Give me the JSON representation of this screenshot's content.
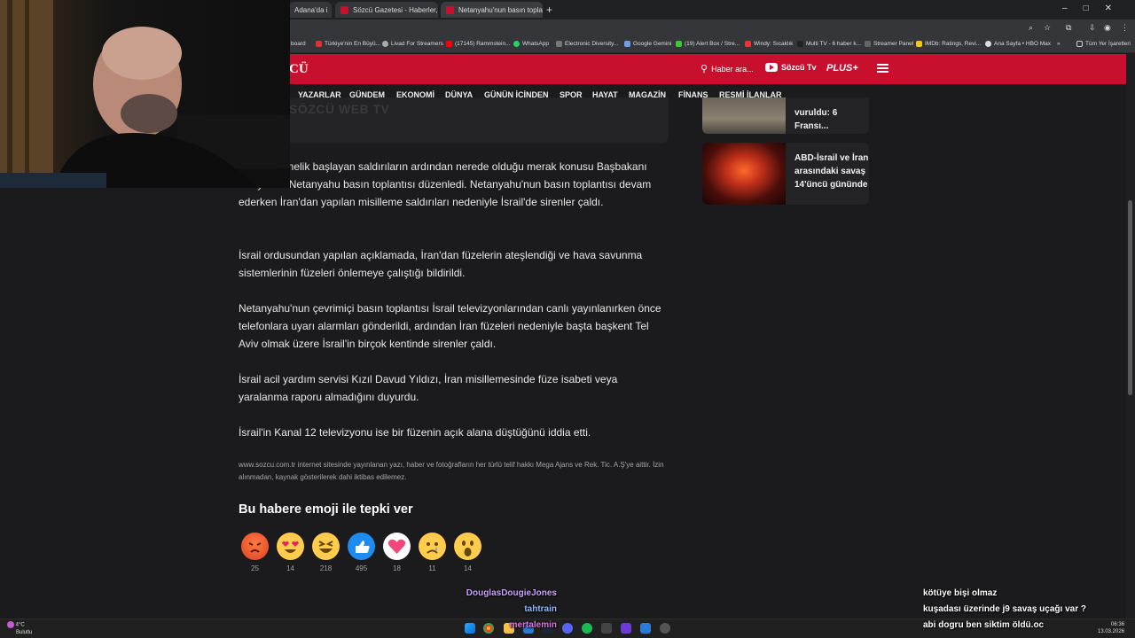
{
  "browser": {
    "tabs": [
      {
        "label": "Adana'da i",
        "active": false
      },
      {
        "label": "Sözcü Gazetesi - Haberler, son",
        "active": false
      },
      {
        "label": "Netanyahu'nun basın toplantısı",
        "active": true
      }
    ],
    "bookmarks": [
      "board",
      "Türkiye'nin En Büyü...",
      "Livad For Streamers",
      "(17145) Rammstein...",
      "WhatsApp",
      "Electronic Diversity...",
      "Google Gemini",
      "(19) Alert Box / Stre...",
      "Windy: Sıcaklık",
      "Multi TV - 6 haber k...",
      "Streamer Panel",
      "IMDb: Ratings, Revi...",
      "Ana Sayfa • HBO Max",
      "Tüm Yer İşaretleri"
    ],
    "bookmarks_overflow": "»"
  },
  "site": {
    "logo": "CÜ",
    "search_placeholder": "Haber ara...",
    "tv_label": "Sözcü Tv",
    "plus_label": "PLUS+",
    "accent_color": "#c8102e",
    "nav": [
      "YAZARLAR",
      "GÜNDEM",
      "EKONOMİ",
      "DÜNYA",
      "GÜNÜN İÇİNDEN",
      "SPOR",
      "HAYAT",
      "MAGAZİN",
      "FİNANS",
      "RESMİ İLANLAR"
    ]
  },
  "article": {
    "video_caption_logo": "SÖZCÜ",
    "video_caption_text": "WEB TV",
    "paragraphs": [
      "a İran'a yönelik başlayan saldırıların ardından nerede olduğu merak konusu Başbakanı Benyamin Netanyahu basın toplantısı düzenledi. Netanyahu'nun basın toplantısı devam ederken İran'dan yapılan misilleme saldırıları nedeniyle İsrail'de sirenler çaldı.",
      "İsrail ordusundan yapılan açıklamada, İran'dan füzelerin ateşlendiği ve hava savunma sistemlerinin füzeleri önlemeye çalıştığı bildirildi.",
      "Netanyahu'nun çevrimiçi basın toplantısı İsrail televizyonlarından canlı yayınlanırken önce telefonlara uyarı alarmları gönderildi, ardından İran füzeleri nedeniyle başta başkent Tel Aviv olmak üzere İsrail'in birçok kentinde sirenler çaldı.",
      "İsrail acil yardım servisi Kızıl Davud Yıldızı, İran misillemesinde füze isabeti veya yaralanma raporu almadığını duyurdu.",
      "İsrail'in Kanal 12 televizyonu ise bir füzenin açık alana düştüğünü iddia etti."
    ],
    "copyright": "www.sozcu.com.tr internet sitesinde yayınlanan yazı, haber ve fotoğrafların her türlü telif hakkı Mega Ajans ve Rek. Tic. A.Ş'ye aittir. İzin alınmadan, kaynak gösterilerek dahi iktibas edilemez.",
    "reactions_title": "Bu habere emoji ile tepki ver",
    "reactions": [
      {
        "name": "angry",
        "count": "25"
      },
      {
        "name": "heart-eyes",
        "count": "14"
      },
      {
        "name": "laughing",
        "count": "218"
      },
      {
        "name": "thumbs-up",
        "count": "495"
      },
      {
        "name": "heart",
        "count": "18"
      },
      {
        "name": "sad",
        "count": "11"
      },
      {
        "name": "surprised",
        "count": "14"
      }
    ]
  },
  "sidebar": {
    "cards": [
      {
        "title": "vuruldu: 6 Fransı..."
      },
      {
        "title": "ABD-İsrail ve İran arasındaki savaş 14'üncü gününde"
      }
    ]
  },
  "chat": [
    {
      "user": "DouglasDougieJones",
      "user_color": "#c9a0ff",
      "message": "kötüye bişi olmaz"
    },
    {
      "user": "tahtrain",
      "user_color": "#8fb8ff",
      "message": "kuşadası üzerinde j9 savaş uçağı var ?"
    },
    {
      "user": "mertalemin",
      "user_color": "#e070e0",
      "message": "abi dogru ben siktim öldü.oc"
    }
  ],
  "taskbar": {
    "weather_temp": "4°C",
    "weather_desc": "Bulutlu",
    "time": "06:36",
    "date": "13.03.2026"
  }
}
